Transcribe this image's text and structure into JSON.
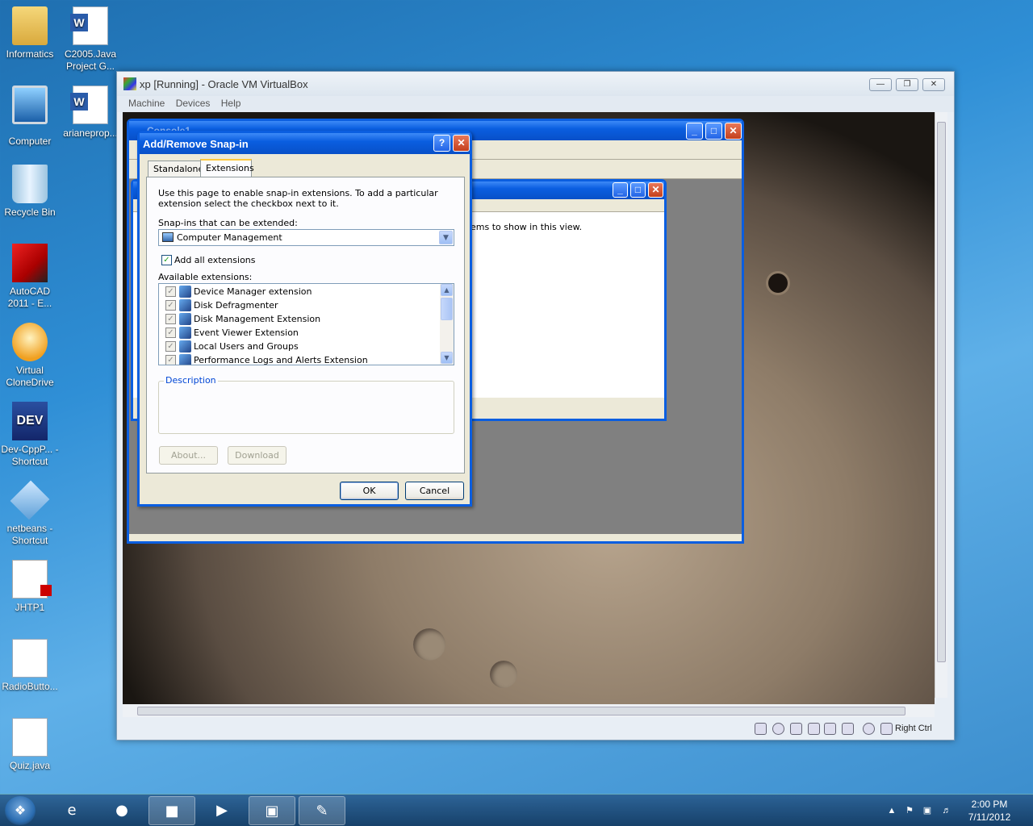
{
  "desktop": {
    "icons": [
      {
        "label": "Informatics",
        "icon": "folder-user-icon"
      },
      {
        "label": "C2005.Java Project G...",
        "icon": "word-doc-icon"
      },
      {
        "label": "Computer",
        "icon": "computer-icon"
      },
      {
        "label": "arianeprop...",
        "icon": "word-doc-icon"
      },
      {
        "label": "Recycle Bin",
        "icon": "recycle-bin-icon"
      },
      {
        "label": "AutoCAD 2011 - E...",
        "icon": "autocad-icon"
      },
      {
        "label": "Virtual CloneDrive",
        "icon": "clonedrive-icon"
      },
      {
        "label": "Dev-CppP... - Shortcut",
        "icon": "devcpp-icon"
      },
      {
        "label": "netbeans - Shortcut",
        "icon": "netbeans-icon"
      },
      {
        "label": "JHTP1",
        "icon": "pdf-icon"
      },
      {
        "label": "RadioButto...",
        "icon": "file-icon"
      },
      {
        "label": "Quiz.java",
        "icon": "file-icon"
      }
    ]
  },
  "vbox": {
    "title": "xp [Running] - Oracle VM VirtualBox",
    "menu": [
      "Machine",
      "Devices",
      "Help"
    ],
    "host_key": "Right Ctrl"
  },
  "guest": {
    "console_title": "Console1",
    "inner_text": "ems to show in this view."
  },
  "dialog": {
    "title": "Add/Remove Snap-in",
    "help_btn": "?",
    "close_btn": "✕",
    "tabs": [
      "Standalone",
      "Extensions"
    ],
    "intro": "Use this page to enable snap-in extensions. To add a particular extension select the checkbox next to it.",
    "snapins_label": "Snap-ins that can be extended:",
    "snapins_value": "Computer Management",
    "add_all_label": "Add all extensions",
    "available_label": "Available extensions:",
    "extensions": [
      "Device Manager extension",
      "Disk Defragmenter",
      "Disk Management Extension",
      "Event Viewer Extension",
      "Local Users and Groups",
      "Performance Logs and Alerts Extension"
    ],
    "description_label": "Description",
    "about_btn": "About...",
    "download_btn": "Download",
    "ok_btn": "OK",
    "cancel_btn": "Cancel"
  },
  "taskbar": {
    "time": "2:00 PM",
    "date": "7/11/2012"
  }
}
